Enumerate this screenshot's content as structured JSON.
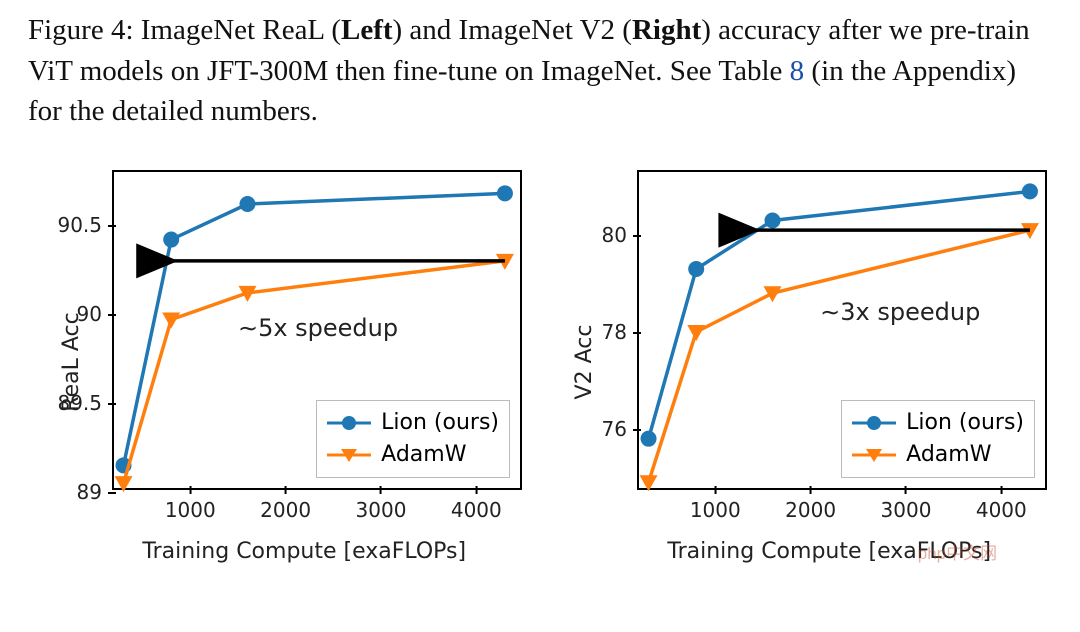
{
  "caption": {
    "t1": "Figure 4: ImageNet ReaL (",
    "bold1": "Left",
    "t2": ") and ImageNet V2 (",
    "bold2": "Right",
    "t3": ") accuracy after we pre-train ViT models on JFT-300M then fine-tune on ImageNet. See Table ",
    "link": "8",
    "t4": " (in the Appendix) for the detailed numbers."
  },
  "chart_data": [
    {
      "type": "line",
      "title": "",
      "xlabel": "Training Compute [exaFLOPs]",
      "ylabel": "ReaL Acc",
      "xlim": [
        200,
        4500
      ],
      "ylim": [
        89.0,
        90.8
      ],
      "xticks": [
        1000,
        2000,
        3000,
        4000
      ],
      "yticks": [
        89.0,
        89.5,
        90.0,
        90.5
      ],
      "annotation": "∼5x speedup",
      "annotation_pos": {
        "x": 1500,
        "y": 90.0
      },
      "arrow": {
        "x1": 4300,
        "y1": 90.3,
        "x2": 800,
        "y2": 90.3
      },
      "legend_pos": "lower right",
      "series": [
        {
          "name": "Lion (ours)",
          "color": "#1f77b4",
          "marker": "circle",
          "x": [
            300,
            800,
            1600,
            4300
          ],
          "y": [
            89.15,
            90.42,
            90.62,
            90.68
          ]
        },
        {
          "name": "AdamW",
          "color": "#ff7f0e",
          "marker": "triangle-down",
          "x": [
            300,
            800,
            1600,
            4300
          ],
          "y": [
            89.05,
            89.97,
            90.12,
            90.3
          ]
        }
      ]
    },
    {
      "type": "line",
      "title": "",
      "xlabel": "Training Compute [exaFLOPs]",
      "ylabel": "V2 Acc",
      "xlim": [
        200,
        4500
      ],
      "ylim": [
        74.7,
        81.3
      ],
      "xticks": [
        1000,
        2000,
        3000,
        4000
      ],
      "yticks": [
        76,
        78,
        80
      ],
      "annotation": "∼3x speedup",
      "annotation_pos": {
        "x": 2100,
        "y": 78.7
      },
      "arrow": {
        "x1": 4300,
        "y1": 80.1,
        "x2": 1400,
        "y2": 80.1
      },
      "legend_pos": "lower right",
      "series": [
        {
          "name": "Lion (ours)",
          "color": "#1f77b4",
          "marker": "circle",
          "x": [
            300,
            800,
            1600,
            4300
          ],
          "y": [
            75.8,
            79.3,
            80.3,
            80.9
          ]
        },
        {
          "name": "AdamW",
          "color": "#ff7f0e",
          "marker": "triangle-down",
          "x": [
            300,
            800,
            1600,
            4300
          ],
          "y": [
            74.9,
            78.0,
            78.8,
            80.1
          ]
        }
      ]
    }
  ],
  "legend": {
    "lion": "Lion (ours)",
    "adamw": "AdamW"
  },
  "watermark": "php中文网"
}
